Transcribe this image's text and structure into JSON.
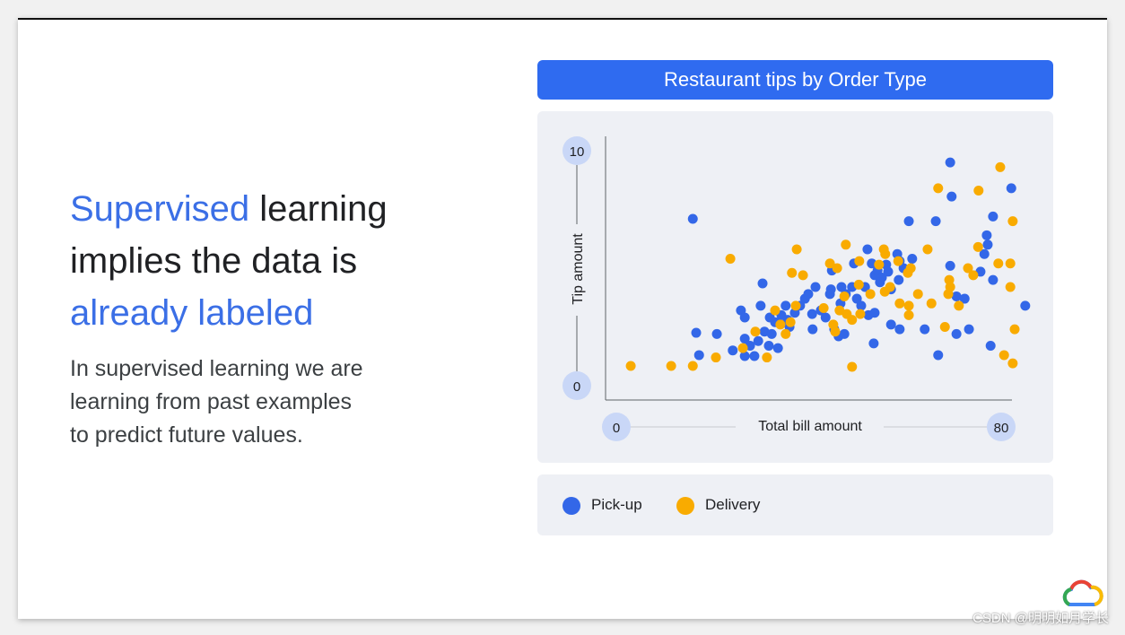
{
  "slide": {
    "headline": {
      "part1": "Supervised",
      "part2": " learning",
      "line2": "implies the data is",
      "line3": "already labeled"
    },
    "paragraph": [
      "In supervised learning we are",
      "learning from past examples",
      "to predict future values."
    ],
    "watermark": "CSDN @明明如月学长",
    "logo": "google-cloud-logo"
  },
  "colors": {
    "accent": "#3b6fe6",
    "title_bar": "#2f6bf0",
    "pickup": "#3367e8",
    "delivery": "#f9ab00",
    "panel": "#eef0f5",
    "tick_circle": "#c9d7f7"
  },
  "chart_data": {
    "type": "scatter",
    "title": "Restaurant tips by Order Type",
    "xlabel": "Total bill amount",
    "ylabel": "Tip amount",
    "x_ticks": [
      "0",
      "80"
    ],
    "y_ticks": [
      "0",
      "10"
    ],
    "xlim": [
      0,
      80
    ],
    "ylim": [
      0,
      10
    ],
    "grid": false,
    "legend_placement": "bottom",
    "series": [
      {
        "name": "Pick-up",
        "color": "#3367e8",
        "points": [
          [
            15.9,
            7.1
          ],
          [
            69.4,
            9.5
          ],
          [
            69.7,
            8.05
          ],
          [
            82.1,
            8.4
          ],
          [
            78.3,
            7.2
          ],
          [
            77.0,
            6.4
          ],
          [
            77.2,
            6.0
          ],
          [
            76.5,
            5.6
          ],
          [
            75.7,
            4.85
          ],
          [
            69.4,
            5.1
          ],
          [
            78.3,
            4.5
          ],
          [
            60.8,
            7.0
          ],
          [
            66.4,
            7.0
          ],
          [
            70.7,
            3.8
          ],
          [
            72.4,
            3.7
          ],
          [
            73.3,
            2.4
          ],
          [
            70.7,
            2.2
          ],
          [
            66.9,
            1.3
          ],
          [
            77.8,
            1.7
          ],
          [
            85.0,
            3.4
          ],
          [
            30.4,
            4.35
          ],
          [
            25.9,
            3.2
          ],
          [
            20.9,
            2.2
          ],
          [
            16.6,
            2.25
          ],
          [
            17.2,
            1.3
          ],
          [
            24.2,
            1.5
          ],
          [
            26.7,
            2.0
          ],
          [
            27.8,
            1.7
          ],
          [
            26.7,
            1.26
          ],
          [
            28.7,
            1.26
          ],
          [
            29.5,
            1.9
          ],
          [
            30.8,
            2.3
          ],
          [
            31.9,
            2.9
          ],
          [
            33.0,
            2.7
          ],
          [
            34.3,
            3.0
          ],
          [
            35.2,
            3.4
          ],
          [
            35.6,
            2.8
          ],
          [
            36.0,
            2.5
          ],
          [
            37.1,
            3.1
          ],
          [
            38.2,
            3.4
          ],
          [
            39.2,
            3.7
          ],
          [
            39.9,
            3.9
          ],
          [
            40.7,
            3.05
          ],
          [
            41.4,
            4.2
          ],
          [
            42.5,
            3.2
          ],
          [
            43.5,
            2.9
          ],
          [
            44.6,
            4.1
          ],
          [
            45.3,
            2.4
          ],
          [
            46.2,
            2.1
          ],
          [
            47.4,
            2.2
          ],
          [
            46.6,
            3.5
          ],
          [
            47.7,
            3.9
          ],
          [
            46.8,
            4.2
          ],
          [
            49.0,
            4.2
          ],
          [
            50.0,
            3.7
          ],
          [
            50.9,
            3.4
          ],
          [
            51.7,
            4.2
          ],
          [
            52.4,
            3.0
          ],
          [
            53.1,
            5.2
          ],
          [
            53.7,
            4.7
          ],
          [
            54.3,
            4.9
          ],
          [
            55.2,
            4.6
          ],
          [
            56.1,
            5.15
          ],
          [
            56.5,
            4.85
          ],
          [
            57.1,
            4.1
          ],
          [
            58.4,
            5.6
          ],
          [
            58.9,
            5.3
          ],
          [
            59.7,
            5.0
          ],
          [
            58.7,
            4.5
          ],
          [
            52.2,
            5.8
          ],
          [
            61.5,
            5.4
          ],
          [
            54.8,
            4.4
          ],
          [
            49.4,
            5.2
          ],
          [
            44.8,
            4.9
          ],
          [
            53.7,
            3.1
          ],
          [
            57.1,
            2.6
          ],
          [
            58.9,
            2.4
          ],
          [
            64.1,
            2.4
          ],
          [
            53.5,
            1.8
          ],
          [
            40.8,
            2.4
          ],
          [
            33.6,
            1.6
          ],
          [
            31.7,
            1.7
          ],
          [
            26.7,
            2.9
          ],
          [
            30.0,
            3.4
          ],
          [
            32.3,
            2.2
          ],
          [
            44.4,
            3.9
          ]
        ]
      },
      {
        "name": "Delivery",
        "color": "#f9ab00",
        "points": [
          [
            3.0,
            0.84
          ],
          [
            11.4,
            0.84
          ],
          [
            15.9,
            0.84
          ],
          [
            20.7,
            1.2
          ],
          [
            23.7,
            5.4
          ],
          [
            37.5,
            5.8
          ],
          [
            36.5,
            4.8
          ],
          [
            38.8,
            4.7
          ],
          [
            47.7,
            6.0
          ],
          [
            44.4,
            5.2
          ],
          [
            45.9,
            5.0
          ],
          [
            50.5,
            5.3
          ],
          [
            55.6,
            5.8
          ],
          [
            55.9,
            5.6
          ],
          [
            54.6,
            5.15
          ],
          [
            58.6,
            5.3
          ],
          [
            60.6,
            4.8
          ],
          [
            56.9,
            4.2
          ],
          [
            55.8,
            4.0
          ],
          [
            52.8,
            3.9
          ],
          [
            62.7,
            3.9
          ],
          [
            50.4,
            4.3
          ],
          [
            49.0,
            2.8
          ],
          [
            50.7,
            3.05
          ],
          [
            47.4,
            3.8
          ],
          [
            46.4,
            3.2
          ],
          [
            47.9,
            3.05
          ],
          [
            45.1,
            2.6
          ],
          [
            45.5,
            2.3
          ],
          [
            43.1,
            3.3
          ],
          [
            37.3,
            3.4
          ],
          [
            36.2,
            2.7
          ],
          [
            34.1,
            2.6
          ],
          [
            33.0,
            3.2
          ],
          [
            28.9,
            2.3
          ],
          [
            26.3,
            1.6
          ],
          [
            31.3,
            1.2
          ],
          [
            35.2,
            2.2
          ],
          [
            49.0,
            0.8
          ],
          [
            64.7,
            5.8
          ],
          [
            66.9,
            8.4
          ],
          [
            75.3,
            8.3
          ],
          [
            79.8,
            9.3
          ],
          [
            82.4,
            7.0
          ],
          [
            75.2,
            5.9
          ],
          [
            73.1,
            5.0
          ],
          [
            74.2,
            4.7
          ],
          [
            79.4,
            5.2
          ],
          [
            81.9,
            5.2
          ],
          [
            81.9,
            4.2
          ],
          [
            69.2,
            4.5
          ],
          [
            69.4,
            4.2
          ],
          [
            69.0,
            3.9
          ],
          [
            71.2,
            3.4
          ],
          [
            65.5,
            3.5
          ],
          [
            60.8,
            3.4
          ],
          [
            60.8,
            3.0
          ],
          [
            68.3,
            2.5
          ],
          [
            82.8,
            2.4
          ],
          [
            80.6,
            1.3
          ],
          [
            82.4,
            0.95
          ],
          [
            58.9,
            3.5
          ],
          [
            61.2,
            5.0
          ]
        ]
      }
    ]
  }
}
